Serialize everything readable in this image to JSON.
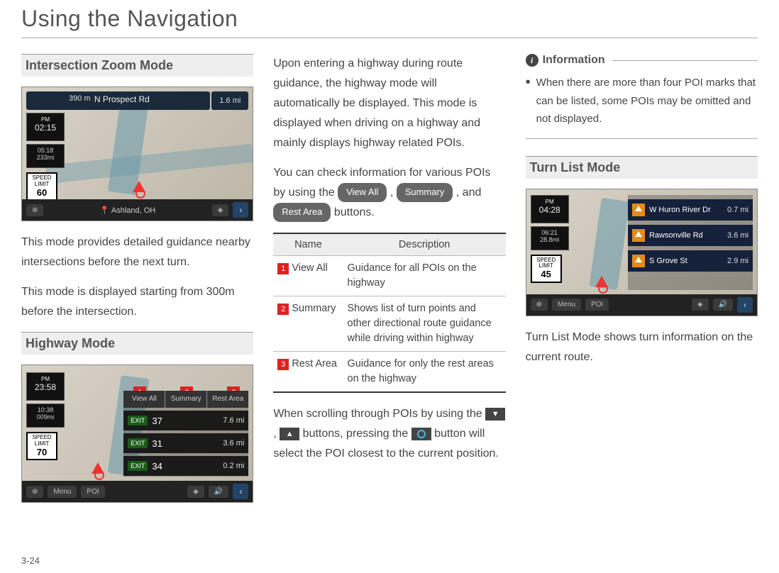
{
  "page_title": "Using the Navigation",
  "page_number": "3-24",
  "col1": {
    "section1_heading": "Intersection Zoom Mode",
    "section1_text1": "This mode provides detailed guidance nearby intersections before the next turn.",
    "section1_text2": "This mode is displayed starting from 300m before the intersection.",
    "section2_heading": "Highway Mode",
    "shot1": {
      "time": "02:15",
      "pm": "PM",
      "eta_time": "05:18",
      "eta_dist": "233mi",
      "speed_limit": "60",
      "speed_label": "SPEED\nLIMIT",
      "top_distance": "390 m",
      "road_name": "N Prospect Rd",
      "right_dist": "1.6 mi",
      "location": "Ashland, OH"
    },
    "shot2": {
      "time": "23:58",
      "pm": "PM",
      "eta_time": "10:38",
      "eta_dist": "009mi",
      "speed_limit": "70",
      "speed_label": "SPEED\nLIMIT",
      "tabs": [
        "View All",
        "Summary",
        "Rest Area"
      ],
      "rows": [
        {
          "exit": "EXIT",
          "num": "37",
          "mi": "7.6 mi"
        },
        {
          "exit": "EXIT",
          "num": "31",
          "mi": "3.6 mi"
        },
        {
          "exit": "EXIT",
          "num": "34",
          "mi": "0.2 mi"
        }
      ],
      "callouts": [
        "1",
        "2",
        "3"
      ],
      "menu": "Menu",
      "poi": "POI"
    }
  },
  "col2": {
    "para1": "Upon entering a highway during route guidance, the highway mode will automatically be displayed. This mode is displayed when driving on a highway and mainly displays highway related POIs.",
    "para2a": "You can check information for various POIs by using the ",
    "btn_viewall": "View All",
    "para2b": " , ",
    "btn_summary": "Summary",
    "para2c": " , and ",
    "btn_restarea": "Rest Area",
    "para2d": " buttons.",
    "table": {
      "h1": "Name",
      "h2": "Description",
      "rows": [
        {
          "n": "1",
          "name": "View All",
          "desc": "Guidance for all POIs on the highway"
        },
        {
          "n": "2",
          "name": "Summary",
          "desc": "Shows list of turn points and other directional route guidance while driving within highway"
        },
        {
          "n": "3",
          "name": "Rest Area",
          "desc": "Guidance for only the rest areas on the highway"
        }
      ]
    },
    "para3a": "When scrolling through POIs by using the ",
    "para3b": " , ",
    "para3c": " buttons, pressing the ",
    "para3d": " button will select the POI closest to the current position."
  },
  "col3": {
    "info_label": "Information",
    "info_bullet": "When there are more than four POI marks that can be listed, some POIs may be omitted and not displayed.",
    "section_heading": "Turn List Mode",
    "shot": {
      "time": "04:28",
      "pm": "PM",
      "eta_time": "06:21",
      "eta_dist": "28.8mi",
      "speed_limit": "45",
      "speed_label": "SPEED\nLIMIT",
      "rows": [
        {
          "name": "W Huron River Dr",
          "mi": "0.7 mi"
        },
        {
          "name": "Rawsonville Rd",
          "mi": "3.6 mi"
        },
        {
          "name": "S Grove St",
          "mi": "2.9 mi"
        }
      ],
      "menu": "Menu",
      "poi": "POI"
    },
    "para": "Turn List Mode shows turn information on the current route."
  }
}
